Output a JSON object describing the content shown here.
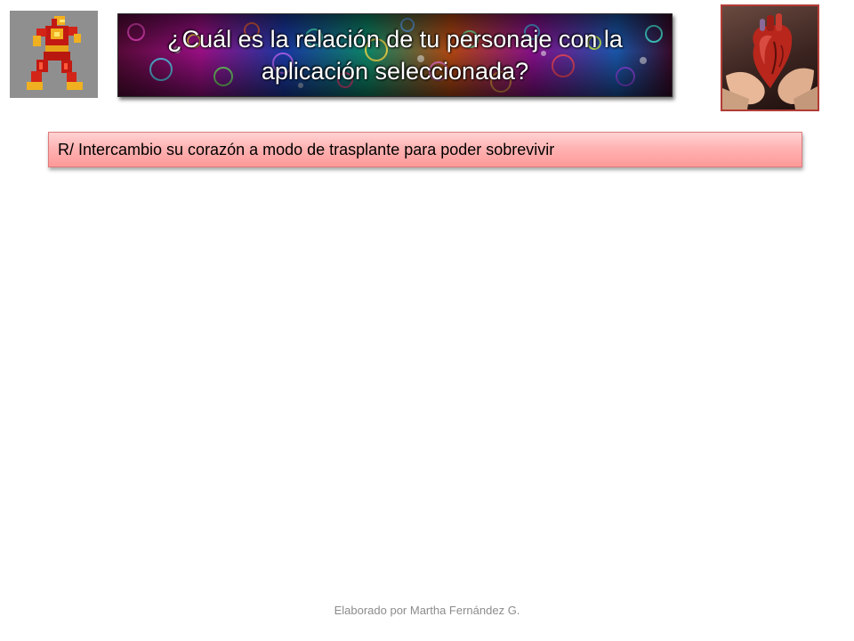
{
  "slide": {
    "title": "¿Cuál es la relación de tu personaje  con la aplicación seleccionada?",
    "answer": "R/ Intercambio su corazón a modo de trasplante para poder sobrevivir",
    "footer": "Elaborado por Martha Fernández G."
  },
  "images": {
    "character": "armored-superhero-sprite",
    "heart": "heart-in-hands-photo"
  },
  "colors": {
    "answer_fill": "#ffb3b3",
    "answer_border": "#e07a7a",
    "heart_frame": "#b23c36",
    "footer_text": "#8c8c8c"
  }
}
